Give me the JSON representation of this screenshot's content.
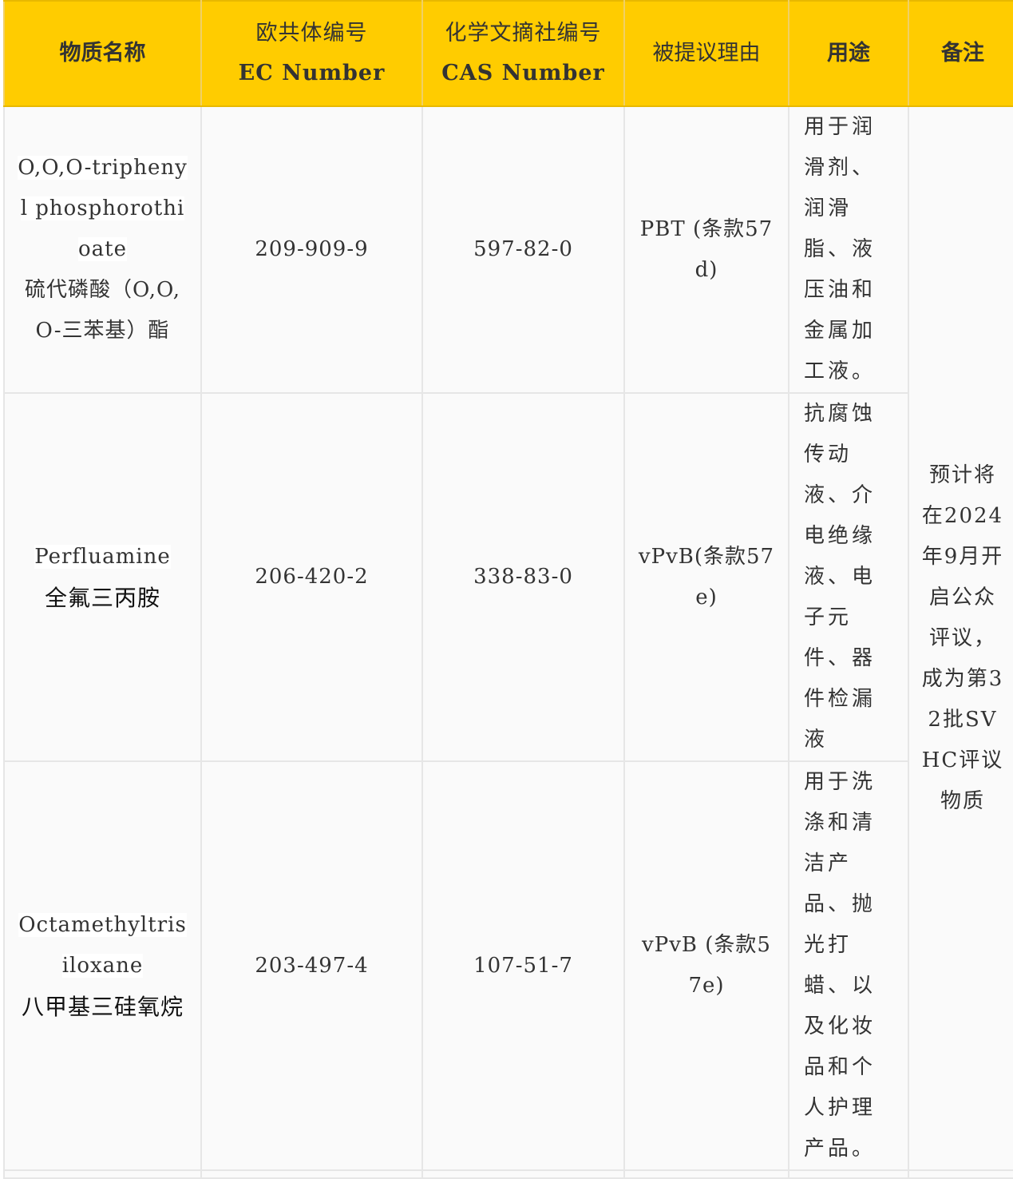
{
  "header": {
    "name": "物质名称",
    "ec_zh": "欧共体编号",
    "ec_en": "EC Number",
    "cas_zh": "化学文摘社编号",
    "cas_en": "CAS Number",
    "reason": "被提议理由",
    "use": "用途",
    "remark": "备注"
  },
  "rows": [
    {
      "name_en": "O,O,O-triphenyl phosphorothioate",
      "name_zh": "硫代磷酸（O,O,O-三苯基）酯",
      "ec": "209-909-9",
      "cas": "597-82-0",
      "reason": "PBT (条款57 d)",
      "use": "用于润滑剂、润滑脂、液压油和金属加工液。"
    },
    {
      "name_en": "Perfluamine",
      "name_zh": "全氟三丙胺",
      "ec": "206-420-2",
      "cas": "338-83-0",
      "reason": "vPvB(条款57 e)",
      "use": "抗腐蚀传动液、介电绝缘液、电子元件、器件检漏液"
    },
    {
      "name_en": "Octamethyltrisiloxane",
      "name_zh": "八甲基三硅氧烷",
      "ec": "203-497-4",
      "cas": "107-51-7",
      "reason": "vPvB (条款57e)",
      "use": "用于洗涤和清洁产品、抛光打蜡、以及化妆品和个人护理产品。"
    }
  ],
  "remark": "预计将在2024年9月开启公众评议，成为第32批SVHC评议物质",
  "colors": {
    "header_bg": "#ffcc00",
    "row_bg": "#fafafa",
    "border": "#e6e6e6"
  }
}
